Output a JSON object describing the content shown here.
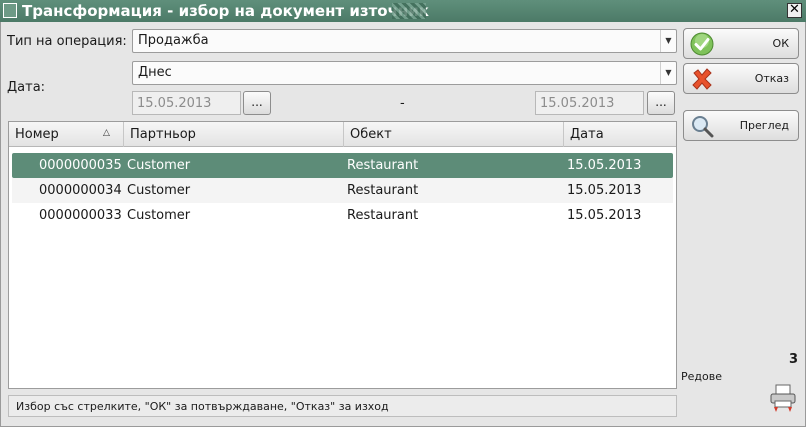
{
  "window": {
    "title": "Трансформация - избор на документ източник",
    "close_label": "✕"
  },
  "form": {
    "operation_label": "Тип на операция:",
    "operation_value": "Продажба",
    "date_label": "Дата:",
    "date_period_value": "Днес",
    "date_from": "15.05.2013",
    "date_to": "15.05.2013",
    "date_separator": "-",
    "picker_label": "..."
  },
  "table": {
    "columns": [
      "Номер",
      "Партньор",
      "Обект",
      "Дата"
    ],
    "sort_column": "Номер",
    "sort_direction": "ascending",
    "rows": [
      {
        "number": "0000000035",
        "partner": "Customer",
        "object": "Restaurant",
        "date": "15.05.2013",
        "selected": true
      },
      {
        "number": "0000000034",
        "partner": "Customer",
        "object": "Restaurant",
        "date": "15.05.2013",
        "selected": false
      },
      {
        "number": "0000000033",
        "partner": "Customer",
        "object": "Restaurant",
        "date": "15.05.2013",
        "selected": false
      }
    ]
  },
  "status": {
    "hint": "Избор със стрелките, \"ОК\" за потвърждаване, \"Отказ\" за изход"
  },
  "buttons": {
    "ok_label": "ОК",
    "cancel_label": "Отказ",
    "preview_label": "Преглед"
  },
  "summary": {
    "row_count": "3",
    "rows_label": "Редове"
  },
  "icons": {
    "ok": "check-icon",
    "cancel": "x-icon",
    "preview": "magnifier-icon",
    "print": "printer-icon",
    "sort": "sort-ascending-icon",
    "dropdown": "chevron-down-icon"
  },
  "colors": {
    "accent": "#5d8c78",
    "title_bar": "#4c7a67"
  }
}
